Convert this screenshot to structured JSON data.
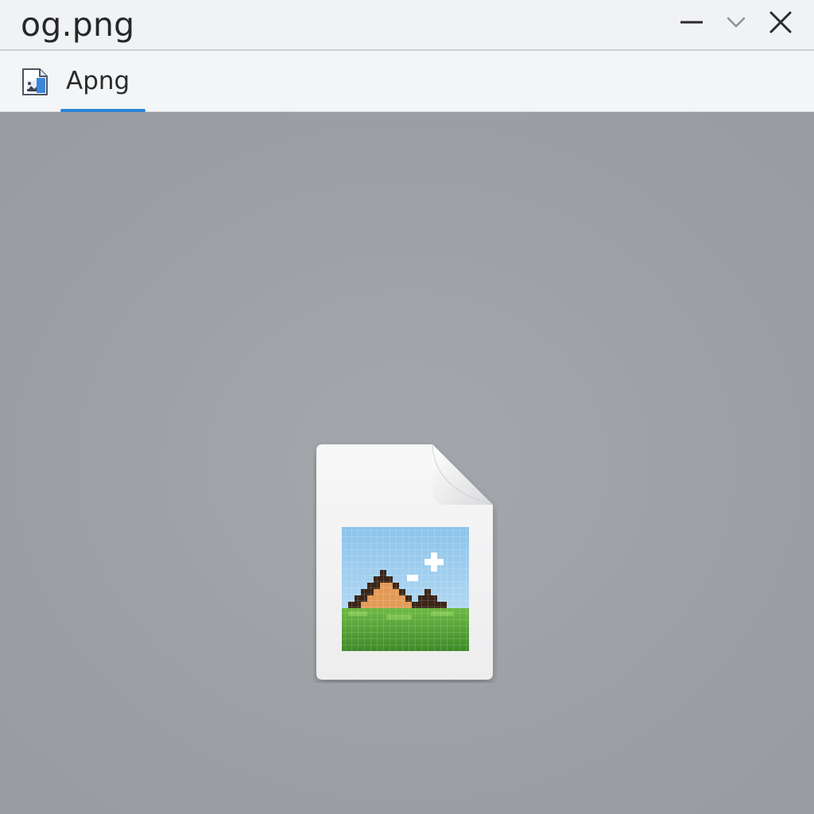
{
  "window": {
    "title": "og.png",
    "controls": {
      "minimize_icon": "minimize-icon",
      "dropdown_icon": "chevron-down-icon",
      "close_icon": "close-icon"
    }
  },
  "tabs": [
    {
      "label": "Apng",
      "icon": "image-file-icon",
      "active": true
    }
  ],
  "viewer": {
    "placeholder_icon": "broken-image-file-icon"
  },
  "colors": {
    "content_background": "#9da1a6",
    "titlebar_background": "#f1f2f3",
    "tab_accent": "#2b84d6"
  }
}
